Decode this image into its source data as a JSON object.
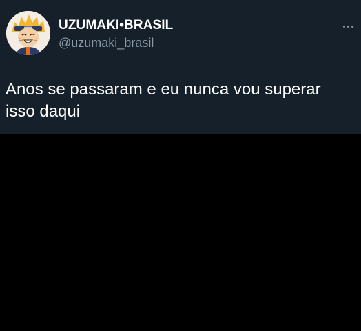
{
  "tweet": {
    "display_name": "UZUMAKI•BRASIL",
    "handle": "@uzumaki_brasil",
    "text": "Anos se passaram e eu nunca vou superar isso daqui",
    "more_icon": "more-horizontal-icon",
    "avatar_icon": "naruto-avatar"
  },
  "colors": {
    "card_background": "#15202b",
    "page_background": "#000000",
    "name": "#ffffff",
    "handle": "#8b98a5",
    "text": "#ffffff"
  }
}
